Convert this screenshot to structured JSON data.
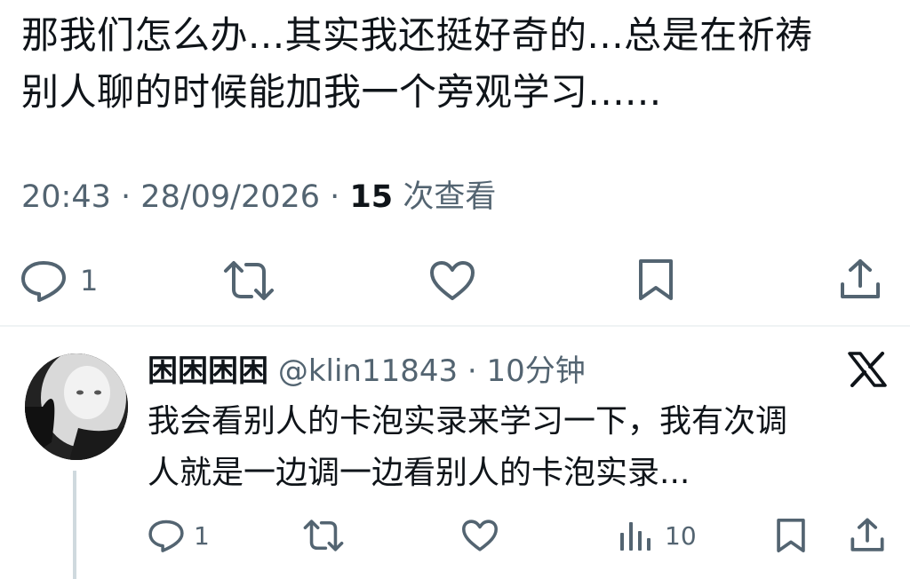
{
  "tweet": {
    "text_line1": "那我们怎么办...其实我还挺好奇的...总是在祈祷",
    "text_line2": "别人聊的时候能加我一个旁观学习......",
    "time": "20:43",
    "date": "28/09/2026",
    "views_count": "15",
    "views_label": "次查看",
    "separator": "·",
    "actions": {
      "reply_count": "1",
      "icons": [
        "reply-icon",
        "retweet-icon",
        "like-icon",
        "bookmark-icon",
        "share-icon"
      ]
    }
  },
  "reply": {
    "display_name": "困困困困",
    "handle": "@klin11843",
    "separator": "·",
    "time_ago": "10分钟",
    "text_line1": "我会看别人的卡泡实录来学习一下，我有次调",
    "text_line2": "人就是一边调一边看别人的卡泡实录...",
    "actions": {
      "reply_count": "1",
      "views_count": "10",
      "icons": [
        "reply-icon",
        "retweet-icon",
        "like-icon",
        "views-icon",
        "bookmark-icon",
        "share-icon"
      ]
    }
  },
  "colors": {
    "text_primary": "#0f1419",
    "text_secondary": "#536471",
    "divider": "#eff3f4",
    "thread_line": "#cfd9de"
  }
}
